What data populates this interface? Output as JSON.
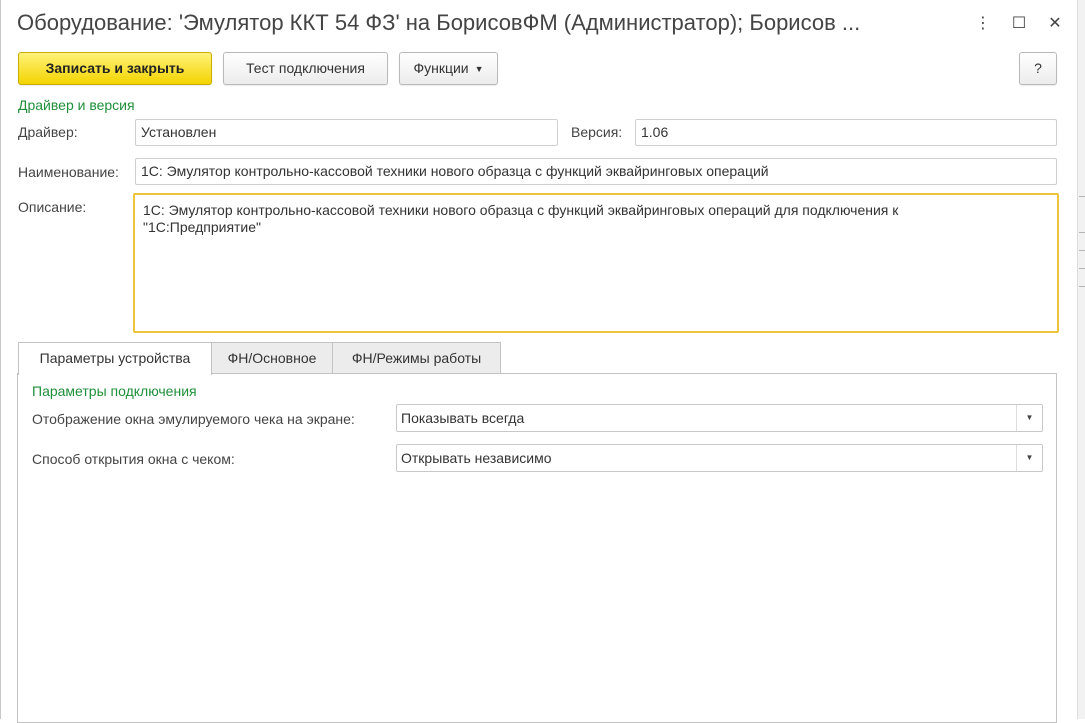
{
  "window": {
    "title": "Оборудование: 'Эмулятор ККТ 54 ФЗ' на БорисовФМ (Администратор); Борисов ...",
    "controls": {
      "menu": "⋮",
      "maximize": "☐",
      "close": "✕"
    }
  },
  "toolbar": {
    "save_close": "Записать и закрыть",
    "test_connection": "Тест подключения",
    "functions": "Функции",
    "help": "?"
  },
  "driver_group": {
    "title": "Драйвер и версия",
    "driver_label": "Драйвер:",
    "driver_value": "Установлен",
    "version_label": "Версия:",
    "version_value": "1.06"
  },
  "name": {
    "label": "Наименование:",
    "value": "1С: Эмулятор контрольно-кассовой техники нового образца с функций эквайринговых операций"
  },
  "description": {
    "label": "Описание:",
    "line1": "1С: Эмулятор контрольно-кассовой техники нового образца с функций эквайринговых операций для подключения к",
    "line2": "\"1С:Предприятие\""
  },
  "tabs": [
    {
      "label": "Параметры устройства",
      "active": true
    },
    {
      "label": "ФН/Основное",
      "active": false
    },
    {
      "label": "ФН/Режимы работы",
      "active": false
    }
  ],
  "connection": {
    "title": "Параметры подключения",
    "display_label": "Отображение окна эмулируемого чека на экране:",
    "display_value": "Показывать всегда",
    "open_label": "Способ открытия окна с чеком:",
    "open_value": "Открывать независимо"
  },
  "colors": {
    "primary_button": "#f3d400",
    "group_title": "#1f8f3a",
    "focus_border": "#f0c43a"
  }
}
